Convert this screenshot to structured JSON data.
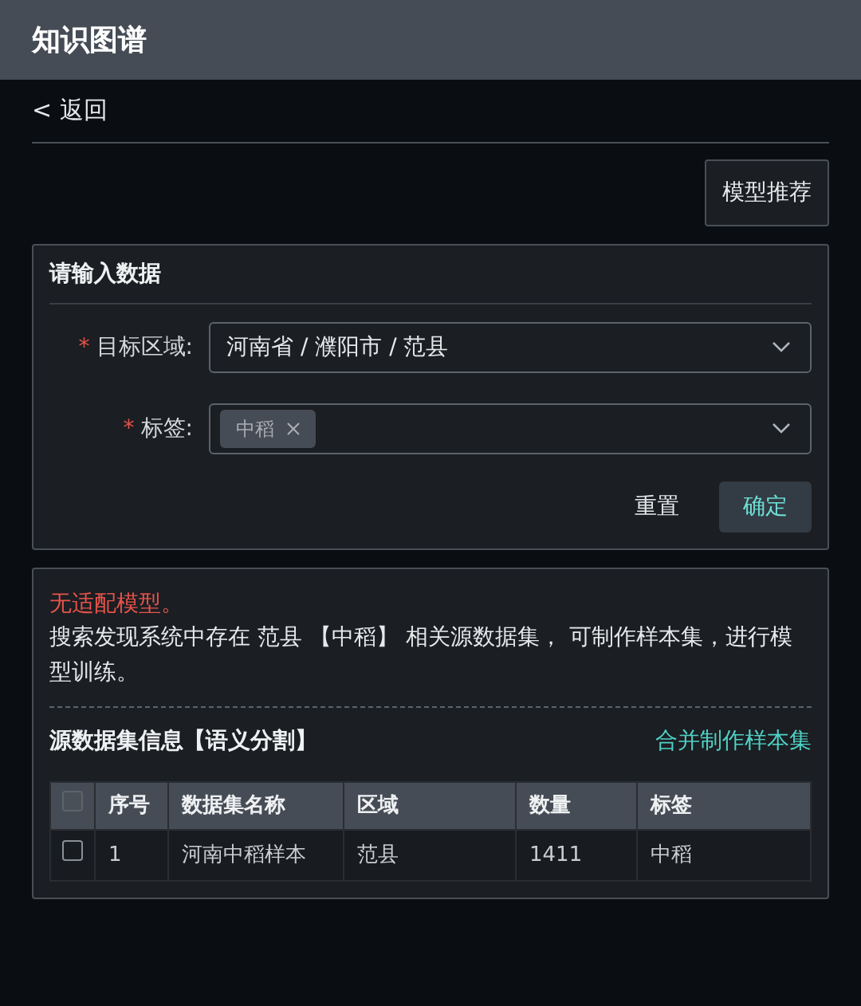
{
  "header": {
    "title": "知识图谱"
  },
  "back_link": {
    "label": "< 返回"
  },
  "recommend_button": {
    "label": "模型推荐"
  },
  "form": {
    "title": "请输入数据",
    "fields": [
      {
        "kind": "select",
        "label": "目标区域:",
        "required_mark": "*",
        "value": "河南省 / 濮阳市 / 范县"
      },
      {
        "kind": "tags",
        "label": "标签:",
        "required_mark": "*",
        "tags": [
          "中稻"
        ]
      }
    ],
    "buttons": [
      {
        "label": "重置",
        "primary": false
      },
      {
        "label": "确定",
        "primary": true
      }
    ]
  },
  "result": {
    "warning": "无适配模型。",
    "message": "搜索发现系统中存在 范县 【中稻】 相关源数据集， 可制作样本集，进行模型训练。",
    "section_title": "源数据集信息【语义分割】",
    "action_link": "合并制作样本集",
    "table": {
      "select_all_checked": false,
      "columns": [
        "序号",
        "数据集名称",
        "区域",
        "数量",
        "标签"
      ],
      "rows": [
        {
          "checked": false,
          "cells": [
            "1",
            "河南中稻样本",
            "范县",
            "1411",
            "中稻"
          ]
        }
      ]
    }
  }
}
